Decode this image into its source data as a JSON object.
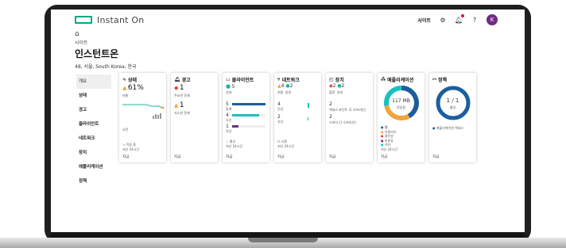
{
  "app": {
    "brand": "Instant On",
    "brand_color": "#01a982"
  },
  "topbar": {
    "site_label": "사이트",
    "avatar_initial": "K"
  },
  "header": {
    "site_small": "사이트",
    "title": "인스턴트온",
    "location": "48, 서울, South Korea, 한국"
  },
  "sidebar": {
    "items": [
      {
        "label": "개요",
        "active": true
      },
      {
        "label": "상태"
      },
      {
        "label": "경고"
      },
      {
        "label": "클라이언트"
      },
      {
        "label": "네트워크"
      },
      {
        "label": "장치"
      },
      {
        "label": "애플리케이션"
      },
      {
        "label": "정책"
      }
    ]
  },
  "cards": {
    "status": {
      "title": "상태",
      "percent": "61%",
      "sub": "보통",
      "xlabel": "오전",
      "foot_note1": "작동 중",
      "foot_note2": "지난 24시간",
      "foot": "지금"
    },
    "alerts": {
      "title": "경고",
      "major_count": "1",
      "major_label": "주요한 문제",
      "minor_count": "1",
      "minor_label": "사소한 문제",
      "foot": "지금"
    },
    "clients": {
      "title": "클라이언트",
      "count": "5",
      "count_label": "상태",
      "rows": [
        {
          "value": "5",
          "label": "합계",
          "fill": 1.0,
          "color": "#1b5e9e"
        },
        {
          "value": "4",
          "label": "무선",
          "fill": 0.8,
          "color": "#17c2c2"
        },
        {
          "value": "1",
          "label": "유선",
          "fill": 0.2,
          "color": "#6f2b86"
        }
      ],
      "note1": "평균",
      "note2": "지난 24시간",
      "foot": "지금"
    },
    "network": {
      "title": "네트워크",
      "warn_count": "4",
      "ok_count": "2",
      "warn_label": "보통",
      "ok_label": "양호",
      "row1_value": "4",
      "row1_label": "무선",
      "row2_value": "2",
      "row2_label": "유선",
      "note1": "사용",
      "note2": "지난 24시간",
      "foot": "지금"
    },
    "devices": {
      "title": "장치",
      "red_count": "2",
      "green_count": "2",
      "red_label": "불량",
      "green_label": "양호",
      "row1_value": "2",
      "row1_label": "액세스 포인트 (1 오프라인)",
      "row2_value": "2",
      "row2_label": "스위치 (1 오프라인)",
      "foot": "지금"
    },
    "apps": {
      "title": "애플리케이션",
      "total": "117 MB",
      "total_label": "전송됨",
      "legend": [
        {
          "label": "웹",
          "color": "#1b5e9e"
        },
        {
          "label": "유틸리티",
          "color": "#f2a33a"
        },
        {
          "label": "생산성",
          "color": "#e03a3a"
        },
        {
          "label": "미분류",
          "color": "#6f2b86"
        },
        {
          "label": "기타",
          "color": "#17c2c2"
        }
      ],
      "note": "지난 24시간",
      "foot": "지금"
    },
    "policy": {
      "title": "정책",
      "ratio": "1 / 1",
      "ratio_label": "활성",
      "legend": "애플리케이션 액세스",
      "foot": "지금"
    }
  }
}
